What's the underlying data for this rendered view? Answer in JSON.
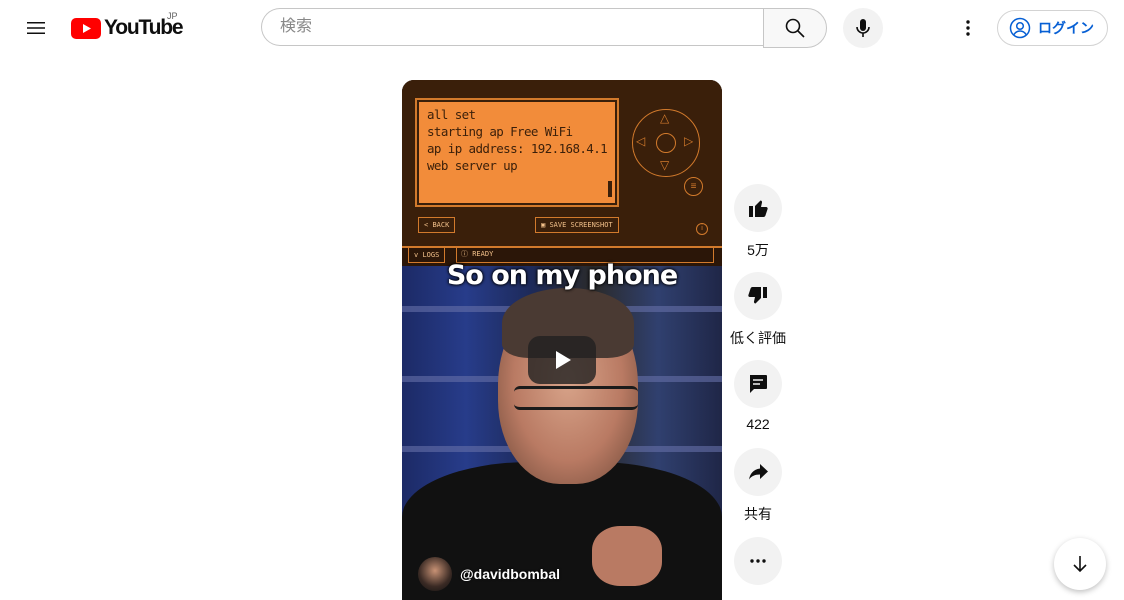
{
  "header": {
    "logo_text": "YouTube",
    "region": "JP",
    "search_placeholder": "検索",
    "login_label": "ログイン"
  },
  "video": {
    "app": {
      "terminal_lines": [
        "all set",
        "starting ap Free WiFi",
        "ap ip address: 192.168.4.1",
        "web server up"
      ],
      "back_label": "BACK",
      "screenshot_label": "SAVE SCREENSHOT",
      "logs_label": "LOGS",
      "status_label": "READY"
    },
    "caption": "So on my phone",
    "channel_handle": "@davidbombal"
  },
  "actions": {
    "like_count": "5万",
    "dislike_label": "低く評価",
    "comment_count": "422",
    "share_label": "共有"
  },
  "colors": {
    "brand_red": "#ff0000",
    "link_blue": "#065fd4",
    "app_orange": "#f28c3a"
  }
}
